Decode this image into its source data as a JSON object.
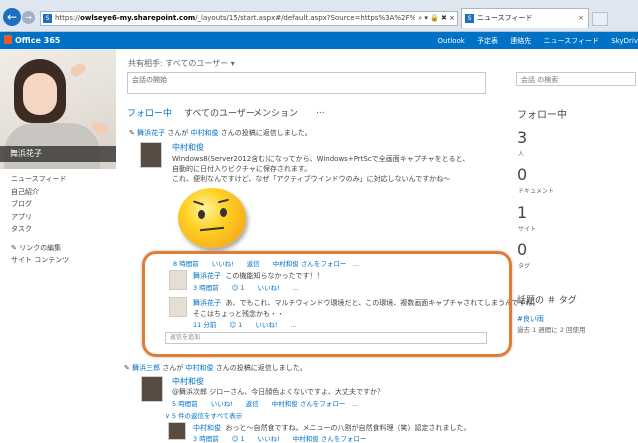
{
  "browser": {
    "url_prefix": "https://",
    "url_host": "owlseye6-my.sharepoint.com",
    "url_rest": "/_layouts/15/start.aspx#/default.aspx?Source=https%3A%2F%2F",
    "addr_controls": "⌕ ▾ 🔒 ✖ ×",
    "tab_title": "ニュースフィード",
    "tab_close": "×"
  },
  "suite": {
    "brand": "Office 365",
    "nav": [
      "Outlook",
      "予定表",
      "連絡先",
      "ニュースフィード",
      "SkyDriv"
    ]
  },
  "profile": {
    "name": "舞浜花子"
  },
  "leftnav": {
    "items": [
      "ニュースフィード",
      "自己紹介",
      "ブログ",
      "アプリ",
      "タスク"
    ],
    "edit_links": "✎ リンクの編集",
    "site_contents": "サイト コンテンツ"
  },
  "share": {
    "label": "共有相手: すべてのユーザー ▾",
    "input_value": "会話の開始"
  },
  "search": {
    "placeholder": "会話 の検索"
  },
  "feedtabs": {
    "following": "フォロー中",
    "everyone": "すべてのユーザー",
    "mentions": "メンション",
    "more": "..."
  },
  "thread1": {
    "header_user": "舞浜花子",
    "header_mid": " さんが ",
    "header_target": "中村和俊",
    "header_tail": " さんの投稿に返信しました。",
    "author": "中村和俊",
    "line1": "Windows8(Server2012含む)になってから、Windows+PrtScで全画面キャプチャをとると、",
    "line2": "自動的に日付入りビクチャに保存されます。",
    "line3": "これ、便利なんですけど、なぜ「アクティブウインドウのみ」に対応しないんですかね～",
    "meta": "8 時間前　　いいね!　　返信　　中村和俊 さんをフォロー　..."
  },
  "reply1": {
    "author": "舞浜花子",
    "text": "この機能知らなかったです！！",
    "meta": "3 時間前　　☺ 1　　いいね!　　..."
  },
  "reply2": {
    "author": "舞浜花子",
    "text": "あ、でもこれ、マルチウィンドウ環境だと、この環境、複数画面キャプチャされてしまうんですね。",
    "text2": "そこはちょっと残念かも・・",
    "meta": "11 分前　　☺ 1　　いいね!　　..."
  },
  "reply_box": {
    "placeholder": "返信を追加"
  },
  "thread2": {
    "header_user": "舞浜三郎",
    "header_mid": " さんが ",
    "header_target": "中村和俊",
    "header_tail": " さんの投稿に返信しました。",
    "author": "中村和俊",
    "line1": "@舞浜次郎 ジローさん、今日顔色よくないですよ、大丈夫ですか？",
    "meta": "5 時間前　　いいね!　　返信　　中村和俊 さんをフォロー　...",
    "show_all": "∨ 5 件の返信をすべて表示",
    "reply_author": "中村和俊",
    "reply_text": "おっと～自然食ですね。メニューの八割が自然食料理（笑）認定されました。",
    "reply_meta": "3 時間前　　☺ 1　　いいね!　　中村和俊 さんをフォロー"
  },
  "following": {
    "title": "フォロー中",
    "people_count": "3",
    "people_label": "人",
    "docs_count": "0",
    "docs_label": "ドキュメント",
    "sites_count": "1",
    "sites_label": "サイト",
    "tags_count": "0",
    "tags_label": "タグ"
  },
  "trending": {
    "title": "話題の ＃ タグ",
    "tag": "#良い雨",
    "desc": "過去 1 週間に 2 回使用"
  }
}
